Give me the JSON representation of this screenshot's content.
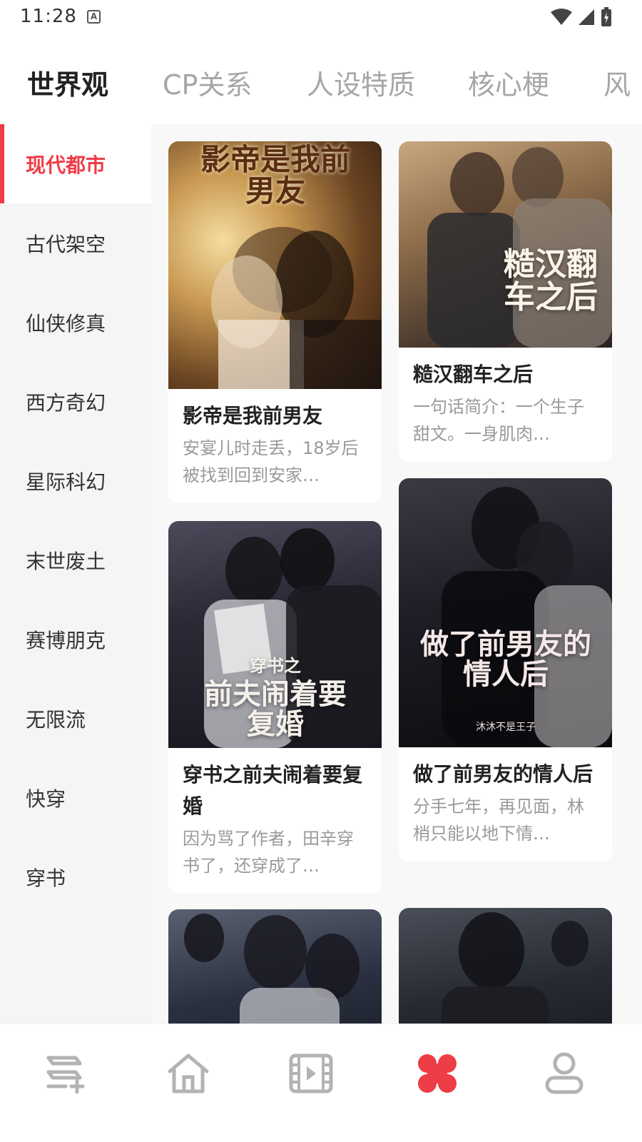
{
  "status_bar": {
    "time": "11:28",
    "notification_icon": "A"
  },
  "top_tabs": [
    {
      "label": "世界观",
      "active": true
    },
    {
      "label": "CP关系",
      "active": false
    },
    {
      "label": "人设特质",
      "active": false
    },
    {
      "label": "核心梗",
      "active": false
    },
    {
      "label": "风",
      "active": false
    }
  ],
  "sidebar": {
    "items": [
      {
        "label": "现代都市",
        "active": true
      },
      {
        "label": "古代架空"
      },
      {
        "label": "仙侠修真"
      },
      {
        "label": "西方奇幻"
      },
      {
        "label": "星际科幻"
      },
      {
        "label": "末世废土"
      },
      {
        "label": "赛博朋克"
      },
      {
        "label": "无限流"
      },
      {
        "label": "快穿"
      },
      {
        "label": "穿书"
      }
    ]
  },
  "cards": [
    {
      "title": "影帝是我前男友",
      "cover_text": "影帝是我前男友",
      "description": "安宴儿时走丢，18岁后被找到回到安家…"
    },
    {
      "title": "糙汉翻车之后",
      "cover_text": "糙汉翻车之后",
      "description": "一句话简介：一个生子甜文。一身肌肉…"
    },
    {
      "title": "穿书之前夫闹着要复婚",
      "cover_text_small": "穿书之",
      "cover_text": "前夫闹着要复婚",
      "description": "因为骂了作者，田辛穿书了，还穿成了…"
    },
    {
      "title": "做了前男友的情人后",
      "cover_text": "做了前男友的情人后",
      "cover_author": "沐沐不是王子",
      "description": "分手七年，再见面，林梢只能以地下情…"
    },
    {
      "title": "",
      "description": ""
    },
    {
      "title": "",
      "description": ""
    }
  ],
  "bottom_nav": [
    {
      "icon": "list-add-icon",
      "active": false
    },
    {
      "icon": "home-icon",
      "active": false
    },
    {
      "icon": "video-icon",
      "active": false
    },
    {
      "icon": "category-icon",
      "active": true
    },
    {
      "icon": "profile-icon",
      "active": false
    }
  ],
  "colors": {
    "accent": "#ee3d46",
    "inactive": "#b3b3b3"
  }
}
